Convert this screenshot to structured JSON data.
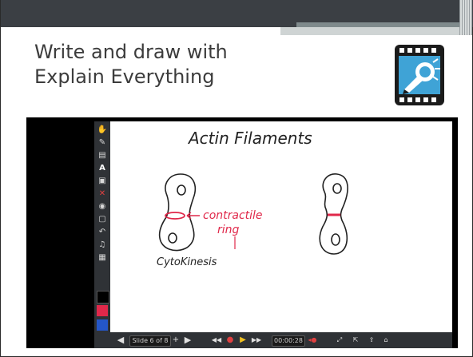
{
  "slide": {
    "title": "Write and draw with\nExplain Everything"
  },
  "app": {
    "name": "Explain Everything",
    "logo_icon": "camera-pencil-icon"
  },
  "canvas": {
    "heading": "Actin Filaments",
    "label_process": "CytoKinesis",
    "label_ring_line1": "contractile",
    "label_ring_line2": "ring",
    "ink_color": "#222222",
    "highlight_color": "#e0284a"
  },
  "toolbar": {
    "tools": [
      "hand-icon",
      "pen-icon",
      "highlighter-icon",
      "text-icon",
      "shape-icon",
      "eraser-icon",
      "laser-icon",
      "insert-icon",
      "undo-icon",
      "audio-icon",
      "more-icon"
    ],
    "colors": [
      "#000000",
      "#e0284a",
      "#2456c8"
    ]
  },
  "bottom_bar": {
    "slide_counter": "Slide 6 of 8",
    "time": "00:00:28"
  },
  "colors": {
    "header": "#3b3f44",
    "toolbar_bg": "#2f3236",
    "record_red": "#e04040",
    "play_yellow": "#f0c020"
  }
}
